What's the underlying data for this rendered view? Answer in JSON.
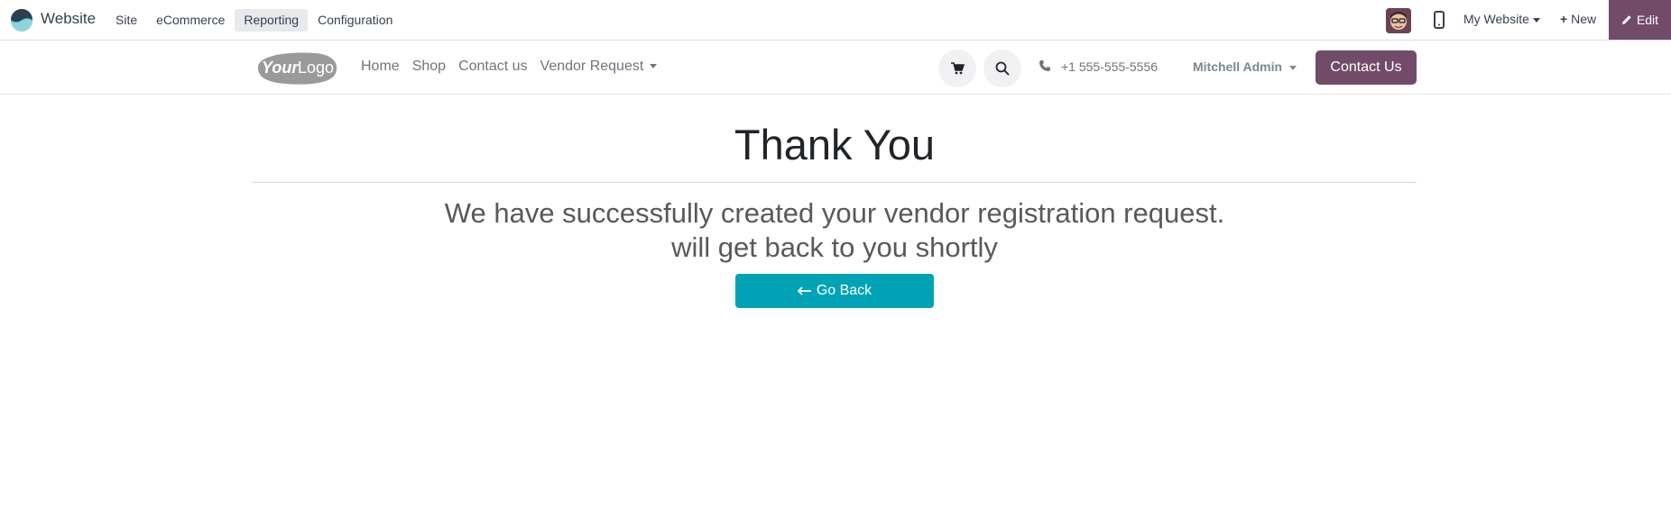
{
  "admin_bar": {
    "app_name": "Website",
    "menu": [
      {
        "label": "Site"
      },
      {
        "label": "eCommerce"
      },
      {
        "label": "Reporting",
        "active": true
      },
      {
        "label": "Configuration"
      }
    ],
    "website_switcher": "My Website",
    "new_label": "New",
    "edit_label": "Edit",
    "accent_color": "#714b67"
  },
  "site_header": {
    "nav": [
      {
        "label": "Home"
      },
      {
        "label": "Shop"
      },
      {
        "label": "Contact us"
      },
      {
        "label": "Vendor Request",
        "dropdown": true
      }
    ],
    "phone": "+1 555-555-5556",
    "user": "Mitchell Admin",
    "contact_button": "Contact Us",
    "icons": [
      "cart-icon",
      "search-icon",
      "phone-icon"
    ]
  },
  "main": {
    "title": "Thank You",
    "message_line1": "We have successfully created your vendor registration request.",
    "message_line2": "will get back to you shortly",
    "go_back_label": "Go Back",
    "button_color": "#00a3b5"
  }
}
